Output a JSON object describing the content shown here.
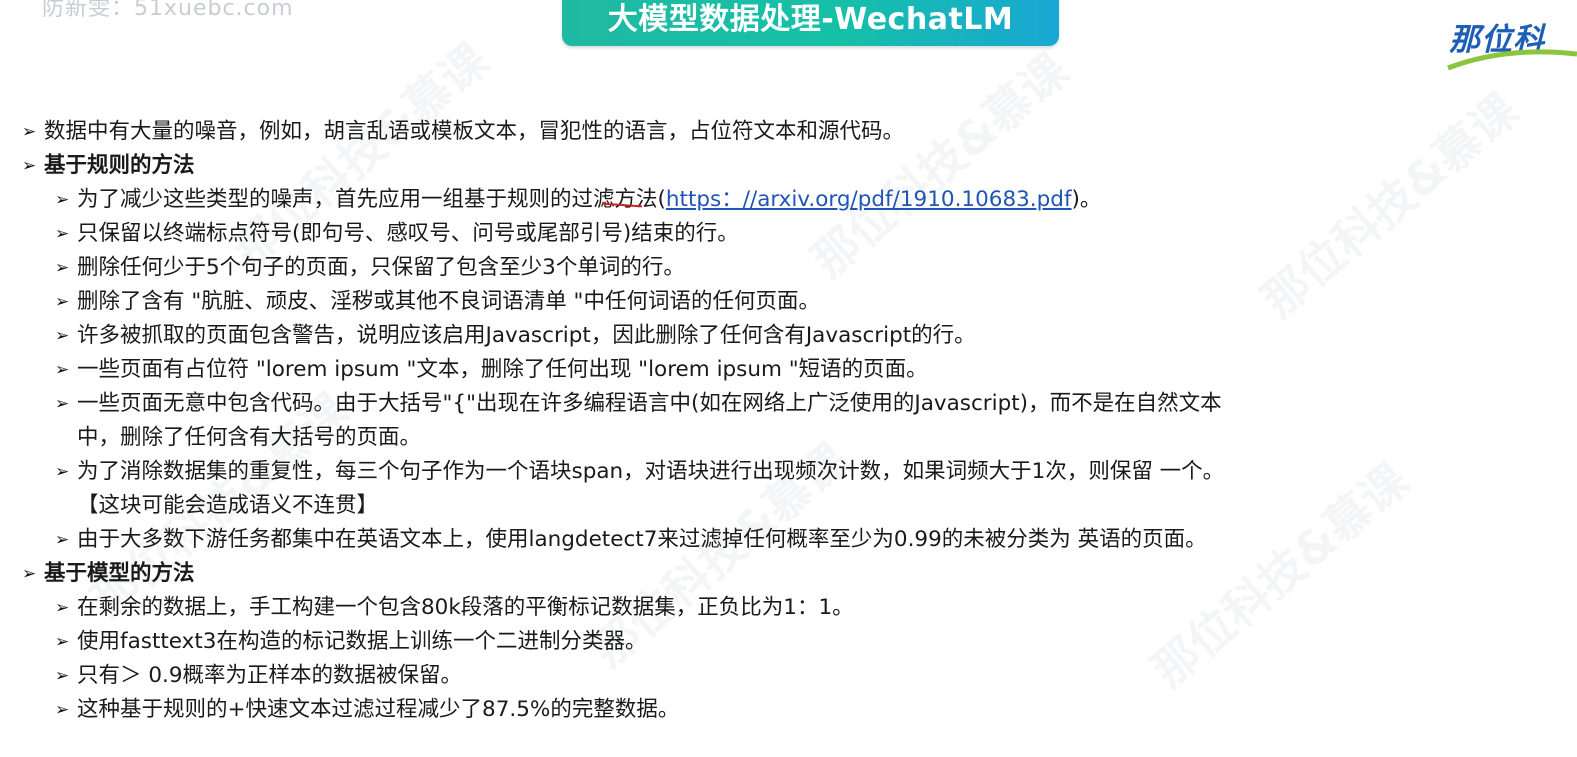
{
  "watermark_top": "防新雯：51xuebc.com",
  "title": "大模型数据处理-WechatLM",
  "logo_text": "那位科",
  "bg_watermark": "那位科技&慕课",
  "lines": [
    {
      "text": "数据中有大量的噪音，例如，胡言乱语或模板文本，冒犯性的语言，占位符文本和源代码。"
    },
    {
      "text": "基于规则的方法"
    },
    {
      "pre": "为了减少这些类型的噪声，首先应用一组基于规则的过滤方法(",
      "link": "https：//arxiv.org/pdf/1910.10683.pdf",
      "post": ")。"
    },
    {
      "text": "只保留以终端标点符号(即句号、感叹号、问号或尾部引号)结束的行。"
    },
    {
      "text": "删除任何少于5个句子的页面，只保留了包含至少3个单词的行。"
    },
    {
      "text": "删除了含有 \"肮脏、顽皮、淫秽或其他不良词语清单 \"中任何词语的任何页面。"
    },
    {
      "text": "许多被抓取的页面包含警告，说明应该启用Javascript，因此删除了任何含有Javascript的行。"
    },
    {
      "text": "一些页面有占位符 \"lorem  ipsum \"文本，删除了任何出现 \"lorem  ipsum \"短语的页面。"
    },
    {
      "text": "一些页面无意中包含代码。由于大括号\"{\"出现在许多编程语言中(如在网络上广泛使用的Javascript)，而不是在自然文本"
    },
    {
      "text": "中，删除了任何含有大括号的页面。"
    },
    {
      "text": "为了消除数据集的重复性，每三个句子作为一个语块span，对语块进行出现频次计数，如果词频大于1次，则保留  一个。"
    },
    {
      "text": "【这块可能会造成语义不连贯】"
    },
    {
      "text": "由于大多数下游任务都集中在英语文本上，使用langdetect7来过滤掉任何概率至少为0.99的未被分类为  英语的页面。"
    },
    {
      "text": "基于模型的方法"
    },
    {
      "text": "在剩余的数据上，手工构建一个包含80k段落的平衡标记数据集，正负比为1：1。"
    },
    {
      "text": "使用fasttext3在构造的标记数据上训练一个二进制分类器。"
    },
    {
      "text": "只有＞ 0.9概率为正样本的数据被保留。"
    },
    {
      "text": "这种基于规则的+快速文本过滤过程减少了87.5%的完整数据。"
    }
  ],
  "bullet_char": "➢"
}
